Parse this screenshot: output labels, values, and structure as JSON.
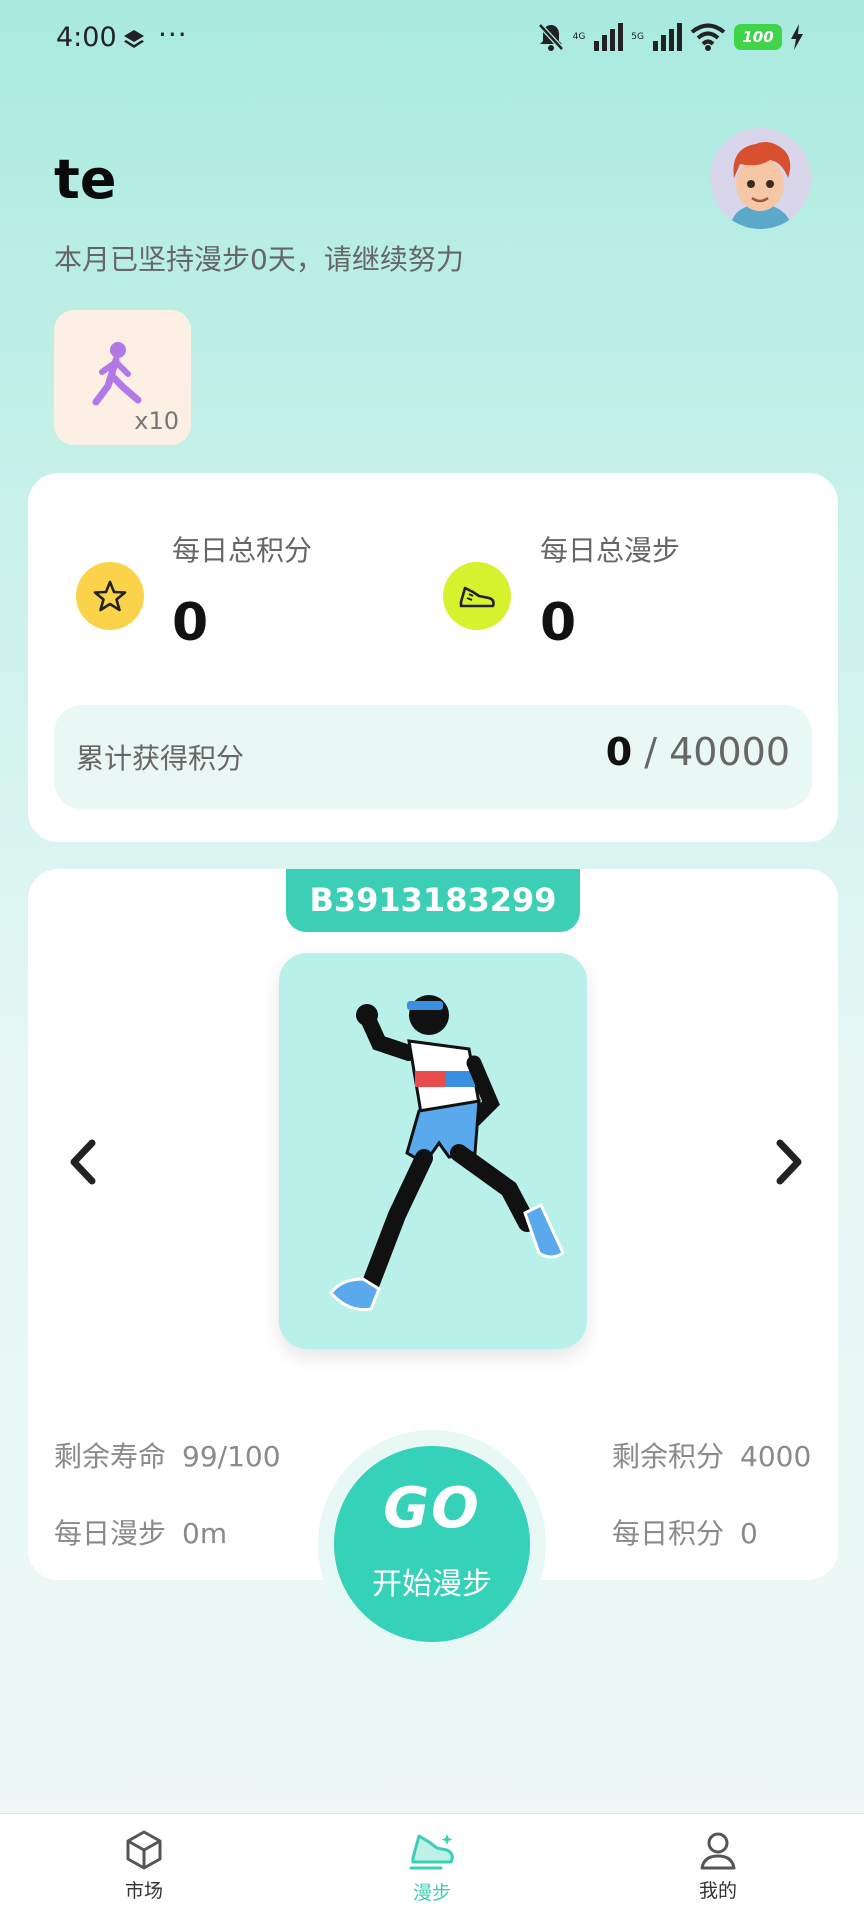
{
  "status_bar": {
    "time": "4:00",
    "dots": "···",
    "net_1": "4G",
    "net_2": "5G",
    "battery": "100"
  },
  "header": {
    "username": "te",
    "subtitle": "本月已坚持漫步0天，请继续努力"
  },
  "badge": {
    "icon": "walking-person-icon",
    "count": "x10"
  },
  "stats": {
    "points_label": "每日总积分",
    "points_value": "0",
    "steps_label": "每日总漫步",
    "steps_value": "0",
    "cumulative_label": "累计获得积分",
    "cumulative_current": "0",
    "cumulative_sep": " / ",
    "cumulative_total": "40000"
  },
  "hero": {
    "code": "B3913183299",
    "remaining_life_label": "剩余寿命",
    "remaining_life_value": "99/100",
    "daily_walk_label": "每日漫步",
    "daily_walk_value": "0m",
    "remaining_points_label": "剩余积分",
    "remaining_points_value": "4000",
    "daily_points_label": "每日积分",
    "daily_points_value": "0"
  },
  "go_button": {
    "text": "GO",
    "label": "开始漫步"
  },
  "nav": {
    "items": [
      {
        "label": "市场",
        "icon": "cube-icon"
      },
      {
        "label": "漫步",
        "icon": "sneaker-icon"
      },
      {
        "label": "我的",
        "icon": "user-icon"
      }
    ],
    "active_index": 1
  },
  "colors": {
    "accent": "#3ccfb6",
    "star_icon_bg": "#fbd34a",
    "shoe_icon_bg": "#d6f12e",
    "badge_bg": "#fcefe3",
    "battery": "#3fd44a"
  }
}
